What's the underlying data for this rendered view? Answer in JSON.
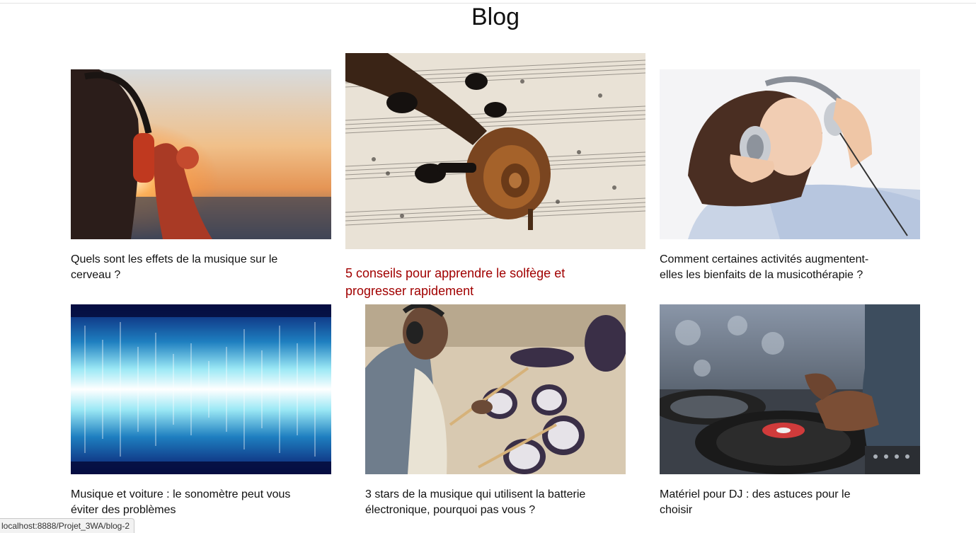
{
  "page": {
    "title": "Blog"
  },
  "posts": [
    {
      "title": "Quels sont les effets de la musique sur le cerveau ?",
      "image": "headphones-sunset-photo"
    },
    {
      "title": "5 conseils pour apprendre le solfège et progresser rapidement",
      "image": "violin-scroll-sheet-music-photo"
    },
    {
      "title": "Comment certaines activités augmentent-elles les bienfaits de la musicothérapie ?",
      "image": "woman-headphones-relaxing-photo"
    },
    {
      "title": "Musique et voiture : le sonomètre peut vous éviter des problèmes",
      "image": "sound-wave-visual"
    },
    {
      "title": "3 stars de la musique qui utilisent la batterie électronique, pourquoi pas vous ?",
      "image": "electronic-drum-player-photo"
    },
    {
      "title": "Matériel pour DJ : des astuces pour le choisir",
      "image": "dj-turntable-photo"
    }
  ],
  "status_bar": {
    "url": "localhost:8888/Projet_3WA/blog-2"
  },
  "colors": {
    "hover_title": "#a10000",
    "text": "#111111"
  }
}
